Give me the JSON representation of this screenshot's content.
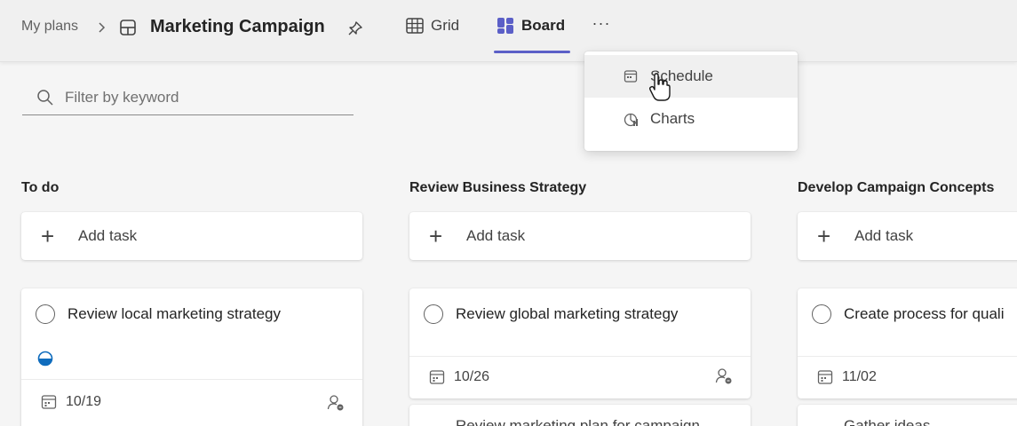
{
  "header": {
    "breadcrumb_root": "My plans",
    "plan_title": "Marketing Campaign",
    "tabs": [
      {
        "label": "Grid",
        "icon": "grid-icon"
      },
      {
        "label": "Board",
        "icon": "board-icon"
      }
    ],
    "more_label": "···",
    "accent_color": "#5b5fc7"
  },
  "menu": {
    "items": [
      {
        "label": "Schedule",
        "icon": "schedule-icon"
      },
      {
        "label": "Charts",
        "icon": "charts-icon"
      }
    ]
  },
  "filter": {
    "placeholder": "Filter by keyword"
  },
  "columns": [
    {
      "title": "To do",
      "add_label": "Add task",
      "tasks": [
        {
          "title": "Review local marketing strategy",
          "due": "10/19",
          "progress": "in-progress"
        }
      ]
    },
    {
      "title": "Review Business Strategy",
      "add_label": "Add task",
      "tasks": [
        {
          "title": "Review global marketing strategy",
          "due": "10/26"
        },
        {
          "title": "Review marketing plan for campaign"
        }
      ]
    },
    {
      "title": "Develop Campaign Concepts",
      "add_label": "Add task",
      "tasks": [
        {
          "title": "Create process for quali",
          "due": "11/02"
        },
        {
          "title": "Gather ideas"
        }
      ]
    }
  ]
}
